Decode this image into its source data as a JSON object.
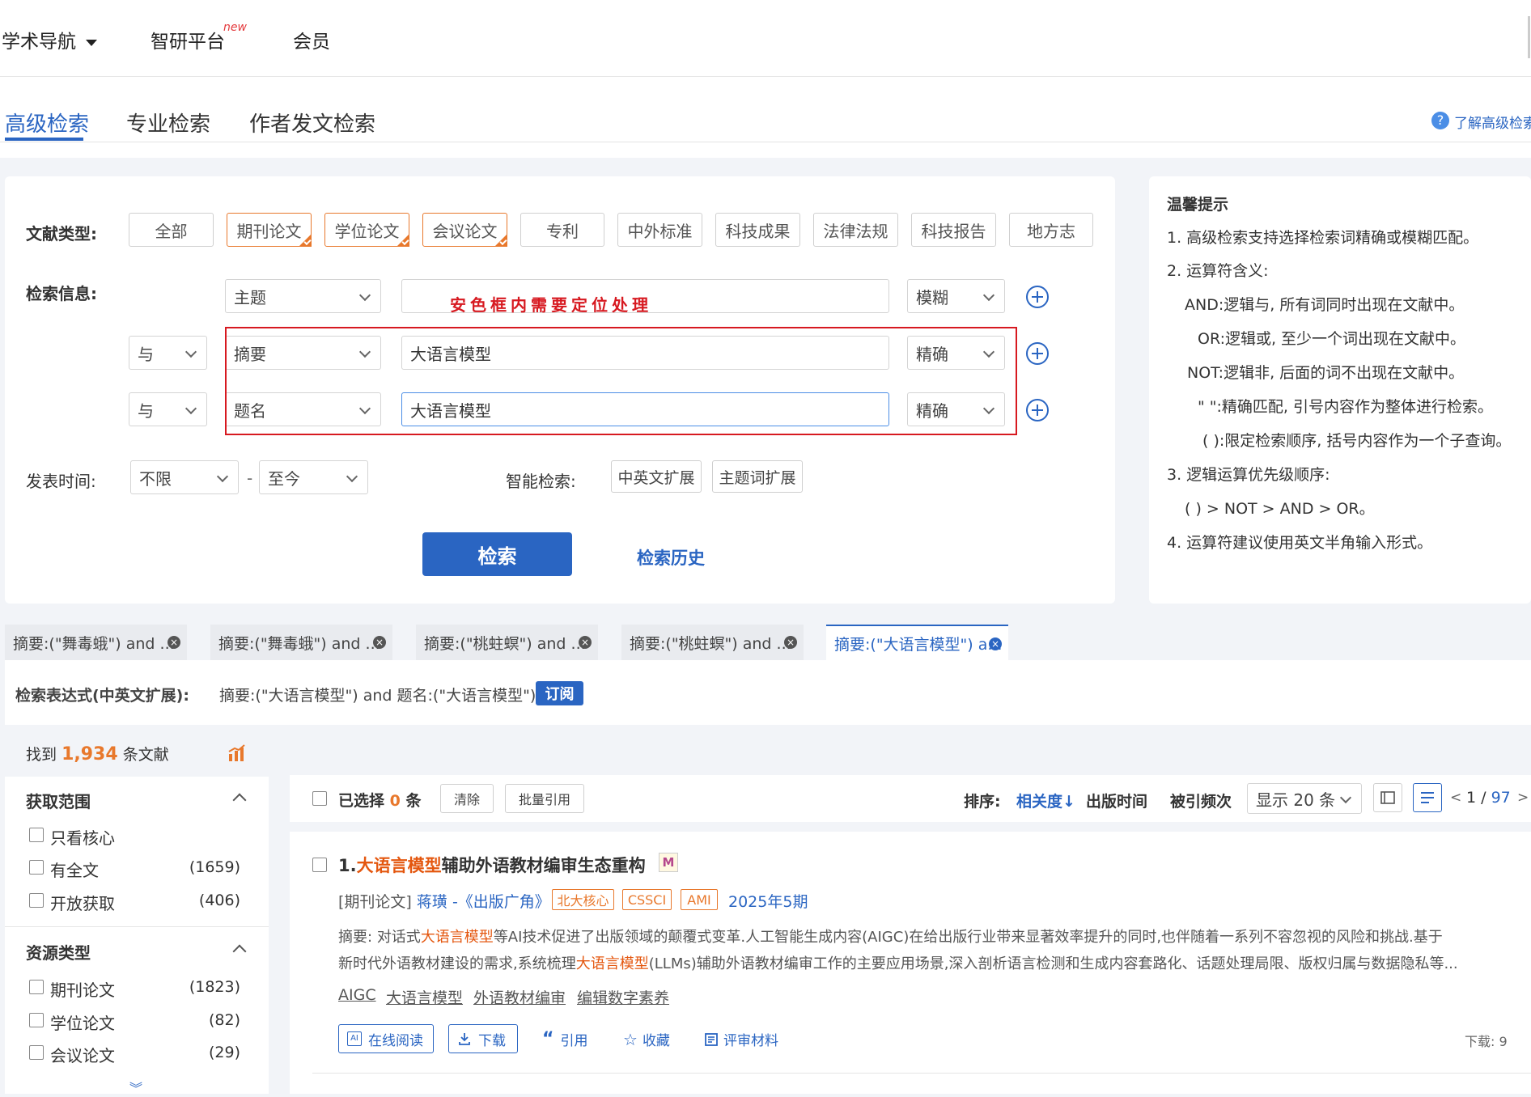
{
  "topnav": {
    "items": [
      "学术导航",
      "智研平台",
      "会员"
    ],
    "new_badge": "new"
  },
  "tabs": {
    "items": [
      "高级检索",
      "专业检索",
      "作者发文检索"
    ],
    "help_link": "了解高级检索"
  },
  "search_form": {
    "doc_type_label": "文献类型:",
    "doc_types": [
      "全部",
      "期刊论文",
      "学位论文",
      "会议论文",
      "专利",
      "中外标准",
      "科技成果",
      "法律法规",
      "科技报告",
      "地方志"
    ],
    "selected_doc_types": [
      "期刊论文",
      "学位论文",
      "会议论文"
    ],
    "info_label": "检索信息:",
    "rows": [
      {
        "logic": "",
        "field": "主题",
        "value": "",
        "match": "模糊"
      },
      {
        "logic": "与",
        "field": "摘要",
        "value": "大语言模型",
        "match": "精确"
      },
      {
        "logic": "与",
        "field": "题名",
        "value": "大语言模型",
        "match": "精确"
      }
    ],
    "annotation": "安色框内需要定位处理",
    "annotation_color": "#d71920",
    "pubtime_label": "发表时间:",
    "pubtime_from": "不限",
    "pubtime_sep": "-",
    "pubtime_to": "至今",
    "smart_label": "智能检索:",
    "smart_options": [
      "中英文扩展",
      "主题词扩展"
    ],
    "search_button": "检索",
    "history_link": "检索历史"
  },
  "tips": {
    "title": "温馨提示",
    "lines": [
      "1. 高级检索支持选择检索词精确或模糊匹配。",
      "2. 运算符含义:",
      "AND:逻辑与, 所有词同时出现在文献中。",
      "OR:逻辑或, 至少一个词出现在文献中。",
      "NOT:逻辑非, 后面的词不出现在文献中。",
      "\" \":精确匹配, 引号内容作为整体进行检索。",
      "( ):限定检索顺序, 括号内容作为一个子查询。",
      "3. 逻辑运算优先级顺序:",
      "( ) > NOT > AND > OR。",
      "4. 运算符建议使用英文半角输入形式。"
    ]
  },
  "history_tabs": [
    "摘要:(\"舞毒蛾\") and ...",
    "摘要:(\"舞毒蛾\") and ...",
    "摘要:(\"桃蛀螟\") and ...",
    "摘要:(\"桃蛀螟\") and ...",
    "摘要:(\"大语言模型\") a..."
  ],
  "expression": {
    "label": "检索表达式(中英文扩展):",
    "value": "摘要:(\"大语言模型\") and 题名:(\"大语言模型\")",
    "subscribe": "订阅"
  },
  "results_summary": {
    "prefix": "找到",
    "count": "1,934",
    "suffix": "条文献"
  },
  "facets": [
    {
      "title": "获取范围",
      "items": [
        {
          "label": "只看核心",
          "count": ""
        },
        {
          "label": "有全文",
          "count": "(1659)"
        },
        {
          "label": "开放获取",
          "count": "(406)"
        }
      ]
    },
    {
      "title": "资源类型",
      "items": [
        {
          "label": "期刊论文",
          "count": "(1823)"
        },
        {
          "label": "学位论文",
          "count": "(82)"
        },
        {
          "label": "会议论文",
          "count": "(29)"
        }
      ]
    }
  ],
  "toolbar": {
    "selected_prefix": "已选择",
    "selected_count": "0",
    "selected_suffix": "条",
    "clear": "清除",
    "batch_cite": "批量引用",
    "sort_label": "排序:",
    "sort_options": [
      "相关度",
      "出版时间",
      "被引频次"
    ],
    "page_size": "显示 20 条",
    "page": "1",
    "pages": "97"
  },
  "result": {
    "index": "1.",
    "title_hl": "大语言模型",
    "title_rest": "辅助外语教材编审生态重构",
    "doc_type": "[期刊论文]",
    "author": "蒋璜",
    "source": "-《出版广角》",
    "tags": [
      "北大核心",
      "CSSCI",
      "AMI"
    ],
    "issue": "2025年5期",
    "abstract_label": "摘要:",
    "abstract_1a": "对话式",
    "abstract_1hl": "大语言模型",
    "abstract_1b": "等AI技术促进了出版领域的颠覆式变革.人工智能生成内容(AIGC)在给出版行业带来显著效率提升的同时,也伴随着一系列不容忽视的风险和挑战.基于",
    "abstract_2a": "新时代外语教材建设的需求,系统梳理",
    "abstract_2hl": "大语言模型",
    "abstract_2b": "(LLMs)辅助外语教材编审工作的主要应用场景,深入剖析语言检测和生成内容套路化、话题处理局限、版权归属与数据隐私等...",
    "keywords": [
      "AIGC",
      "大语言模型",
      "外语教材编审",
      "编辑数字素养"
    ],
    "actions": [
      "在线阅读",
      "下载",
      "引用",
      "收藏",
      "评审材料"
    ],
    "downloads": "下载: 9"
  }
}
